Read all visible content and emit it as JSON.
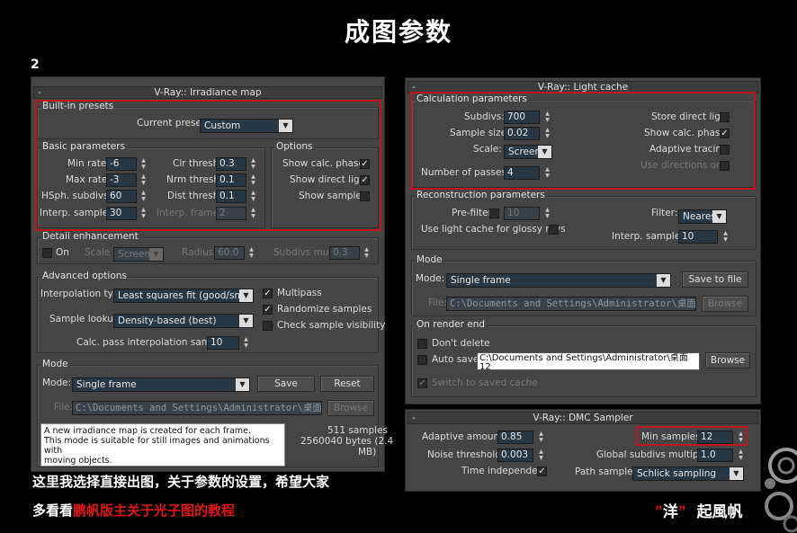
{
  "title": "成图参数",
  "page_number": "2",
  "caption": {
    "line1": "这里我选择直接出图，关于参数的设置，希望大家",
    "line2_prefix": "多看看",
    "line2_highlight": "鹏帆版主关于光子图的教程"
  },
  "signature": {
    "open_quote": "\"",
    "name": "洋",
    "close_quote": "\"",
    "rest": "起風帆"
  },
  "irradiance": {
    "header": "V-Ray:: Irradiance map",
    "minus": "-",
    "presets": {
      "title": "Built-in presets",
      "current_label": "Current preset:",
      "current_value": "Custom"
    },
    "basic": {
      "title": "Basic parameters",
      "min_rate_label": "Min rate:",
      "min_rate": "-6",
      "max_rate_label": "Max rate:",
      "max_rate": "-3",
      "hsph_label": "HSph. subdivs:",
      "hsph": "60",
      "interp_label": "Interp. samples:",
      "interp": "30",
      "clr_label": "Clr thresh:",
      "clr": "0.3",
      "nrm_label": "Nrm thresh:",
      "nrm": "0.1",
      "dist_label": "Dist thresh:",
      "dist": "0.1",
      "frames_label": "Interp. frames",
      "frames": "2"
    },
    "options": {
      "title": "Options",
      "show_calc": "Show calc. phase",
      "show_direct": "Show direct light",
      "show_samples": "Show samples"
    },
    "detail": {
      "title": "Detail enhancement",
      "on": "On",
      "scale_label": "Scale",
      "scale": "Screen",
      "radius_label": "Radius",
      "radius": "60.0",
      "subdivs_label": "Subdivs mult.",
      "subdivs": "0.3"
    },
    "advanced": {
      "title": "Advanced options",
      "interp_type_label": "Interpolation type:",
      "interp_type": "Least squares fit (good/smooth",
      "lookup_label": "Sample lookup:",
      "lookup": "Density-based (best)",
      "calc_pass_label": "Calc. pass interpolation samples:",
      "calc_pass": "10",
      "multipass": "Multipass",
      "randomize": "Randomize samples",
      "check_vis": "Check sample visibility"
    },
    "mode": {
      "title": "Mode",
      "mode_label": "Mode:",
      "mode_value": "Single frame",
      "save": "Save",
      "reset": "Reset",
      "file_label": "File:",
      "file_path": "C:\\Documents and Settings\\Administrator\\桌面",
      "browse": "Browse",
      "desc1": "A new irradiance map is created for each frame.",
      "desc2": "This mode is suitable for still images and animations with",
      "desc3": "moving objects.",
      "samples": "511 samples",
      "bytes": "2560040 bytes (2.4",
      "mb": "MB)"
    }
  },
  "lightcache": {
    "header": "V-Ray:: Light cache",
    "minus": "-",
    "calc": {
      "title": "Calculation parameters",
      "subdivs_label": "Subdivs:",
      "subdivs": "700",
      "size_label": "Sample size:",
      "size": "0.02",
      "scale_label": "Scale:",
      "scale": "Screen",
      "passes_label": "Number of passes:",
      "passes": "4",
      "store_direct": "Store direct light",
      "show_calc": "Show calc. phase",
      "adaptive": "Adaptive tracing",
      "use_dirs": "Use directions only"
    },
    "recon": {
      "title": "Reconstruction parameters",
      "prefilter_label": "Pre-filter:",
      "prefilter": "10",
      "glossy": "Use light cache for glossy rays",
      "filter_label": "Filter:",
      "filter": "Nearest",
      "interp_label": "Interp. samples:",
      "interp": "10"
    },
    "mode": {
      "title": "Mode",
      "mode_label": "Mode:",
      "mode_value": "Single frame",
      "save_file": "Save to file",
      "file_label": "File:",
      "file_path": "C:\\Documents and Settings\\Administrator\\桌面",
      "browse": "Browse"
    },
    "render_end": {
      "title": "On render end",
      "dont_delete": "Don't delete",
      "auto_save": "Auto save:",
      "auto_path": "C:\\Documents and Settings\\Administrator\\桌面",
      "auto_path2": "12",
      "browse": "Browse",
      "switch": "Switch to saved cache"
    }
  },
  "dmc": {
    "header": "V-Ray:: DMC Sampler",
    "minus": "-",
    "adaptive_label": "Adaptive amount:",
    "adaptive": "0.85",
    "noise_label": "Noise threshold:",
    "noise": "0.003",
    "time_label": "Time independent",
    "min_label": "Min samples:",
    "min": "12",
    "global_label": "Global subdivs multiplier:",
    "global": "1.0",
    "path_label": "Path sampler:",
    "path": "Schlick sampling"
  }
}
